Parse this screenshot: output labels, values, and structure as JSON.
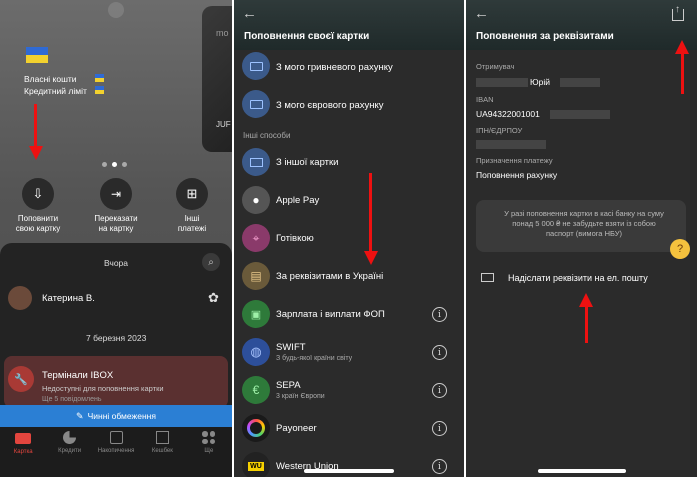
{
  "panel1": {
    "balance_own": "Власні кошти",
    "credit_limit": "Кредитний ліміт",
    "card_brand_partial": "mo",
    "card_corner_text": "JUF",
    "actions": [
      {
        "label": "Поповнити\nсвою картку"
      },
      {
        "label": "Переказати\nна картку"
      },
      {
        "label": "Інші\nплатежі"
      }
    ],
    "feed_date_yesterday": "Вчора",
    "contact_name": "Катерина В.",
    "feed_date_2": "7 березня 2023",
    "terminal_title": "Термінали IBOX",
    "terminal_sub": "Недоступні для поповнення картки",
    "terminal_sub2": "Ще 5 повідомлень",
    "limits_banner": "Чинні обмеження",
    "tabs": [
      {
        "label": "Картка"
      },
      {
        "label": "Кредити"
      },
      {
        "label": "Накопичення"
      },
      {
        "label": "Кешбек"
      },
      {
        "label": "Ще"
      }
    ]
  },
  "panel2": {
    "title": "Поповнення своєї картки",
    "section_other": "Інші способи",
    "options": [
      {
        "label": "З мого гривневого рахунку",
        "sub": ""
      },
      {
        "label": "З мого єврового рахунку",
        "sub": ""
      },
      {
        "label": "З іншої картки",
        "sub": ""
      },
      {
        "label": "Apple Pay",
        "sub": ""
      },
      {
        "label": "Готівкою",
        "sub": ""
      },
      {
        "label": "За реквізитами в Україні",
        "sub": ""
      },
      {
        "label": "Зарплата і виплати ФОП",
        "sub": ""
      },
      {
        "label": "SWIFT",
        "sub": "З будь-якої країни світу"
      },
      {
        "label": "SEPA",
        "sub": "3 країн Європи"
      },
      {
        "label": "Payoneer",
        "sub": ""
      },
      {
        "label": "Western Union",
        "sub": ""
      }
    ],
    "wu_badge": "WU"
  },
  "panel3": {
    "title": "Поповнення за реквізитами",
    "recipient_label": "Отримувач",
    "recipient_value": "Юрій",
    "iban_label": "IBAN",
    "iban_value": "UA94322001001",
    "tax_label": "ІПН/ЄДРПОУ",
    "purpose_label": "Призначення платежу",
    "purpose_value": "Поповнення рахунку",
    "notice": "У разі поповнення картки в касі банку на суму понад 5 000 ₴ не забудьте взяти із собою паспорт (вимога НБУ)",
    "send_email": "Надіслати реквізити на ел. пошту"
  },
  "colors": {
    "accent_red": "#e11d1d",
    "banner_blue": "#2b7fd4",
    "bg_dark": "#2b2b2b",
    "tab_active": "#e3453e"
  }
}
